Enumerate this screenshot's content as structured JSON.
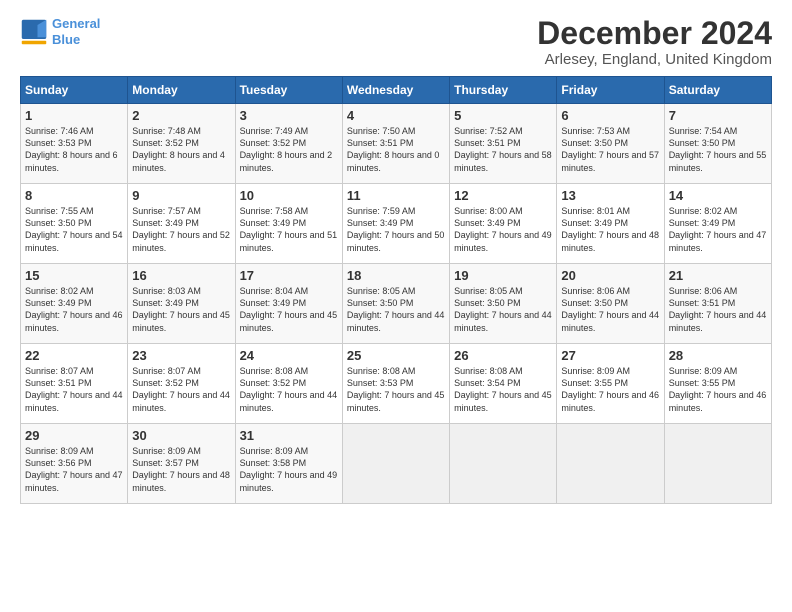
{
  "logo": {
    "line1": "General",
    "line2": "Blue"
  },
  "title": "December 2024",
  "location": "Arlesey, England, United Kingdom",
  "days_of_week": [
    "Sunday",
    "Monday",
    "Tuesday",
    "Wednesday",
    "Thursday",
    "Friday",
    "Saturday"
  ],
  "weeks": [
    [
      {
        "day": "1",
        "sunrise": "Sunrise: 7:46 AM",
        "sunset": "Sunset: 3:53 PM",
        "daylight": "Daylight: 8 hours and 6 minutes."
      },
      {
        "day": "2",
        "sunrise": "Sunrise: 7:48 AM",
        "sunset": "Sunset: 3:52 PM",
        "daylight": "Daylight: 8 hours and 4 minutes."
      },
      {
        "day": "3",
        "sunrise": "Sunrise: 7:49 AM",
        "sunset": "Sunset: 3:52 PM",
        "daylight": "Daylight: 8 hours and 2 minutes."
      },
      {
        "day": "4",
        "sunrise": "Sunrise: 7:50 AM",
        "sunset": "Sunset: 3:51 PM",
        "daylight": "Daylight: 8 hours and 0 minutes."
      },
      {
        "day": "5",
        "sunrise": "Sunrise: 7:52 AM",
        "sunset": "Sunset: 3:51 PM",
        "daylight": "Daylight: 7 hours and 58 minutes."
      },
      {
        "day": "6",
        "sunrise": "Sunrise: 7:53 AM",
        "sunset": "Sunset: 3:50 PM",
        "daylight": "Daylight: 7 hours and 57 minutes."
      },
      {
        "day": "7",
        "sunrise": "Sunrise: 7:54 AM",
        "sunset": "Sunset: 3:50 PM",
        "daylight": "Daylight: 7 hours and 55 minutes."
      }
    ],
    [
      {
        "day": "8",
        "sunrise": "Sunrise: 7:55 AM",
        "sunset": "Sunset: 3:50 PM",
        "daylight": "Daylight: 7 hours and 54 minutes."
      },
      {
        "day": "9",
        "sunrise": "Sunrise: 7:57 AM",
        "sunset": "Sunset: 3:49 PM",
        "daylight": "Daylight: 7 hours and 52 minutes."
      },
      {
        "day": "10",
        "sunrise": "Sunrise: 7:58 AM",
        "sunset": "Sunset: 3:49 PM",
        "daylight": "Daylight: 7 hours and 51 minutes."
      },
      {
        "day": "11",
        "sunrise": "Sunrise: 7:59 AM",
        "sunset": "Sunset: 3:49 PM",
        "daylight": "Daylight: 7 hours and 50 minutes."
      },
      {
        "day": "12",
        "sunrise": "Sunrise: 8:00 AM",
        "sunset": "Sunset: 3:49 PM",
        "daylight": "Daylight: 7 hours and 49 minutes."
      },
      {
        "day": "13",
        "sunrise": "Sunrise: 8:01 AM",
        "sunset": "Sunset: 3:49 PM",
        "daylight": "Daylight: 7 hours and 48 minutes."
      },
      {
        "day": "14",
        "sunrise": "Sunrise: 8:02 AM",
        "sunset": "Sunset: 3:49 PM",
        "daylight": "Daylight: 7 hours and 47 minutes."
      }
    ],
    [
      {
        "day": "15",
        "sunrise": "Sunrise: 8:02 AM",
        "sunset": "Sunset: 3:49 PM",
        "daylight": "Daylight: 7 hours and 46 minutes."
      },
      {
        "day": "16",
        "sunrise": "Sunrise: 8:03 AM",
        "sunset": "Sunset: 3:49 PM",
        "daylight": "Daylight: 7 hours and 45 minutes."
      },
      {
        "day": "17",
        "sunrise": "Sunrise: 8:04 AM",
        "sunset": "Sunset: 3:49 PM",
        "daylight": "Daylight: 7 hours and 45 minutes."
      },
      {
        "day": "18",
        "sunrise": "Sunrise: 8:05 AM",
        "sunset": "Sunset: 3:50 PM",
        "daylight": "Daylight: 7 hours and 44 minutes."
      },
      {
        "day": "19",
        "sunrise": "Sunrise: 8:05 AM",
        "sunset": "Sunset: 3:50 PM",
        "daylight": "Daylight: 7 hours and 44 minutes."
      },
      {
        "day": "20",
        "sunrise": "Sunrise: 8:06 AM",
        "sunset": "Sunset: 3:50 PM",
        "daylight": "Daylight: 7 hours and 44 minutes."
      },
      {
        "day": "21",
        "sunrise": "Sunrise: 8:06 AM",
        "sunset": "Sunset: 3:51 PM",
        "daylight": "Daylight: 7 hours and 44 minutes."
      }
    ],
    [
      {
        "day": "22",
        "sunrise": "Sunrise: 8:07 AM",
        "sunset": "Sunset: 3:51 PM",
        "daylight": "Daylight: 7 hours and 44 minutes."
      },
      {
        "day": "23",
        "sunrise": "Sunrise: 8:07 AM",
        "sunset": "Sunset: 3:52 PM",
        "daylight": "Daylight: 7 hours and 44 minutes."
      },
      {
        "day": "24",
        "sunrise": "Sunrise: 8:08 AM",
        "sunset": "Sunset: 3:52 PM",
        "daylight": "Daylight: 7 hours and 44 minutes."
      },
      {
        "day": "25",
        "sunrise": "Sunrise: 8:08 AM",
        "sunset": "Sunset: 3:53 PM",
        "daylight": "Daylight: 7 hours and 45 minutes."
      },
      {
        "day": "26",
        "sunrise": "Sunrise: 8:08 AM",
        "sunset": "Sunset: 3:54 PM",
        "daylight": "Daylight: 7 hours and 45 minutes."
      },
      {
        "day": "27",
        "sunrise": "Sunrise: 8:09 AM",
        "sunset": "Sunset: 3:55 PM",
        "daylight": "Daylight: 7 hours and 46 minutes."
      },
      {
        "day": "28",
        "sunrise": "Sunrise: 8:09 AM",
        "sunset": "Sunset: 3:55 PM",
        "daylight": "Daylight: 7 hours and 46 minutes."
      }
    ],
    [
      {
        "day": "29",
        "sunrise": "Sunrise: 8:09 AM",
        "sunset": "Sunset: 3:56 PM",
        "daylight": "Daylight: 7 hours and 47 minutes."
      },
      {
        "day": "30",
        "sunrise": "Sunrise: 8:09 AM",
        "sunset": "Sunset: 3:57 PM",
        "daylight": "Daylight: 7 hours and 48 minutes."
      },
      {
        "day": "31",
        "sunrise": "Sunrise: 8:09 AM",
        "sunset": "Sunset: 3:58 PM",
        "daylight": "Daylight: 7 hours and 49 minutes."
      },
      null,
      null,
      null,
      null
    ]
  ]
}
